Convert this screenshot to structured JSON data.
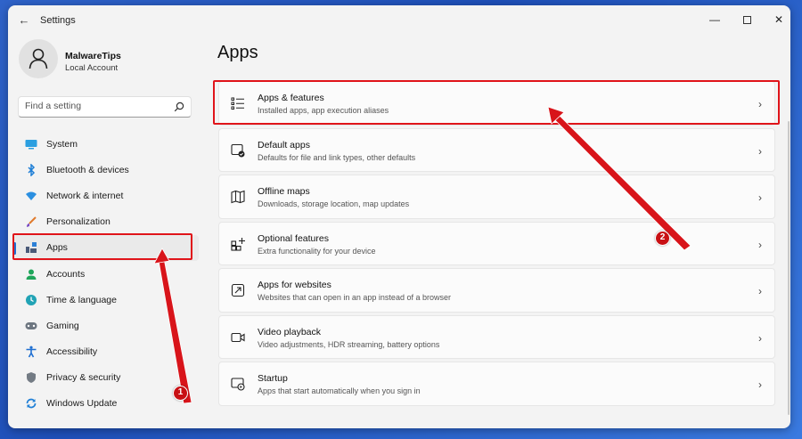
{
  "window": {
    "title": "Settings",
    "back_glyph": "←",
    "minimize_glyph": "—",
    "close_glyph": "✕"
  },
  "profile": {
    "name": "MalwareTips",
    "account_type": "Local Account"
  },
  "search": {
    "placeholder": "Find a setting"
  },
  "sidebar": {
    "items": [
      {
        "label": "System",
        "icon": "system-icon"
      },
      {
        "label": "Bluetooth & devices",
        "icon": "bluetooth-icon"
      },
      {
        "label": "Network & internet",
        "icon": "network-icon"
      },
      {
        "label": "Personalization",
        "icon": "brush-icon"
      },
      {
        "label": "Apps",
        "icon": "apps-icon",
        "active": true
      },
      {
        "label": "Accounts",
        "icon": "accounts-icon"
      },
      {
        "label": "Time & language",
        "icon": "time-language-icon"
      },
      {
        "label": "Gaming",
        "icon": "gaming-icon"
      },
      {
        "label": "Accessibility",
        "icon": "accessibility-icon"
      },
      {
        "label": "Privacy & security",
        "icon": "shield-icon"
      },
      {
        "label": "Windows Update",
        "icon": "windows-update-icon"
      }
    ]
  },
  "main": {
    "title": "Apps",
    "cards": [
      {
        "title": "Apps & features",
        "description": "Installed apps, app execution aliases",
        "icon": "list-icon"
      },
      {
        "title": "Default apps",
        "description": "Defaults for file and link types, other defaults",
        "icon": "default-apps-icon"
      },
      {
        "title": "Offline maps",
        "description": "Downloads, storage location, map updates",
        "icon": "map-icon"
      },
      {
        "title": "Optional features",
        "description": "Extra functionality for your device",
        "icon": "optional-features-icon"
      },
      {
        "title": "Apps for websites",
        "description": "Websites that can open in an app instead of a browser",
        "icon": "apps-websites-icon"
      },
      {
        "title": "Video playback",
        "description": "Video adjustments, HDR streaming, battery options",
        "icon": "video-icon"
      },
      {
        "title": "Startup",
        "description": "Apps that start automatically when you sign in",
        "icon": "startup-icon"
      }
    ],
    "chevron": "›"
  },
  "annotations": {
    "step1": "1",
    "step2": "2",
    "color": "#e0141a"
  },
  "colors": {
    "accent": "#1f6fd1",
    "window_bg": "#f3f3f3",
    "card_bg": "#fbfbfb"
  }
}
